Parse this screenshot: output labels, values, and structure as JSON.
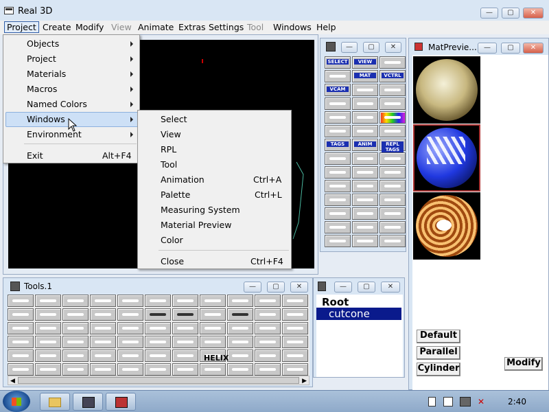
{
  "app": {
    "title": "Real 3D",
    "icon": "app-window-icon"
  },
  "menubar": {
    "items": [
      {
        "label": "Project",
        "enabled": true,
        "active": true
      },
      {
        "label": "Create",
        "enabled": true
      },
      {
        "label": "Modify",
        "enabled": true
      },
      {
        "label": "View",
        "enabled": false
      },
      {
        "label": "Animate",
        "enabled": true
      },
      {
        "label": "Extras",
        "enabled": true
      },
      {
        "label": "Settings",
        "enabled": true
      },
      {
        "label": "Tool",
        "enabled": false
      },
      {
        "label": "Windows",
        "enabled": true
      },
      {
        "label": "Help",
        "enabled": true
      }
    ]
  },
  "project_menu": {
    "items": [
      {
        "label": "Objects",
        "submenu": true
      },
      {
        "label": "Project",
        "submenu": true
      },
      {
        "label": "Materials",
        "submenu": true
      },
      {
        "label": "Macros",
        "submenu": true
      },
      {
        "label": "Named Colors",
        "submenu": true
      },
      {
        "label": "Windows",
        "submenu": true,
        "highlighted": true
      },
      {
        "label": "Environment",
        "submenu": true
      },
      {
        "label": "Exit",
        "shortcut": "Alt+F4"
      }
    ]
  },
  "windows_submenu": {
    "items": [
      {
        "label": "Select",
        "shortcut": ""
      },
      {
        "label": "View",
        "shortcut": ""
      },
      {
        "label": "RPL",
        "shortcut": ""
      },
      {
        "label": "Tool",
        "shortcut": ""
      },
      {
        "label": "Animation",
        "shortcut": "Ctrl+A"
      },
      {
        "label": "Palette",
        "shortcut": "Ctrl+L"
      },
      {
        "label": "Measuring System",
        "shortcut": ""
      },
      {
        "label": "Material Preview",
        "shortcut": ""
      },
      {
        "label": "Color",
        "shortcut": ""
      },
      {
        "label": "Close",
        "shortcut": "Ctrl+F4"
      }
    ]
  },
  "matpreview": {
    "title": "MatPrevie..."
  },
  "palette_labels": [
    "SELECT",
    "VIEW",
    "",
    "",
    "MAT",
    "VCTRL",
    "VCAM",
    "",
    "",
    "",
    "",
    "",
    "",
    "",
    "",
    "",
    "",
    "",
    "TAGS",
    "ANIM",
    "REPL TAGS"
  ],
  "tools": {
    "title": "Tools.1",
    "helix_label": "HELIX"
  },
  "tree": {
    "items": [
      "Root",
      "cutcone"
    ]
  },
  "buttons": {
    "default": "Default",
    "parallel": "Parallel",
    "cylinder": "Cylinder",
    "modify": "Modify"
  },
  "taskbar": {
    "clock": "2:40"
  },
  "colors": {
    "title_bg": "#d9e6f4",
    "selection": "#0a1a8c",
    "viewport": "#000000",
    "wire": "#4ab8a0"
  }
}
